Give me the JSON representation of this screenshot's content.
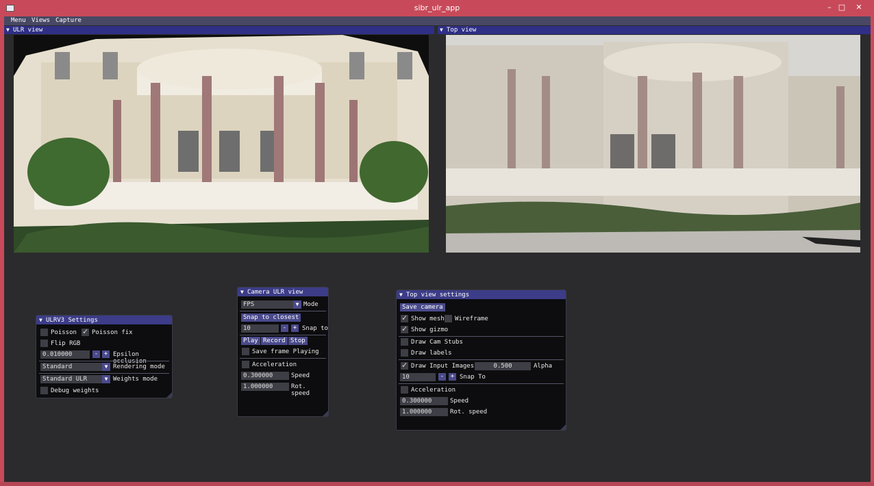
{
  "window": {
    "title": "sibr_ulr_app",
    "minimize": "–",
    "maximize": "□",
    "close": "✕"
  },
  "menu": [
    "Menu",
    "Views",
    "Capture"
  ],
  "ulr_view": {
    "label": "ULR view"
  },
  "top_view": {
    "label": "Top view"
  },
  "ulrv3": {
    "title": "ULRV3 Settings",
    "poisson": "Poisson",
    "poisson_fix": "Poisson fix",
    "flip_rgb": "Flip RGB",
    "epsilon_value": "0.010000",
    "epsilon_label": "Epsilon occlusion",
    "minus": "-",
    "plus": "+",
    "rendering_value": "Standard",
    "rendering_label": "Rendering mode",
    "weights_value": "Standard ULR",
    "weights_label": "Weights mode",
    "debug_weights": "Debug weights"
  },
  "camera": {
    "title": "Camera ULR view",
    "mode_value": "FPS",
    "mode_label": "Mode",
    "snap_closest": "Snap to closest",
    "snap_value": "10",
    "snap_label": "Snap to",
    "play": "Play",
    "record": "Record",
    "stop": "Stop",
    "save_frame": "Save frame Playing",
    "acceleration": "Acceleration",
    "speed_value": "0.300000",
    "speed_label": "Speed",
    "rot_value": "1.000000",
    "rot_label": "Rot. speed"
  },
  "topview_settings": {
    "title": "Top view settings",
    "save_camera": "Save camera",
    "show_mesh": "Show mesh",
    "wireframe": "Wireframe",
    "show_gizmo": "Show gizmo",
    "draw_cam_stubs": "Draw Cam Stubs",
    "draw_labels": "Draw labels",
    "draw_input_images": "Draw Input Images",
    "alpha_value": "0.500",
    "alpha_label": "Alpha",
    "snap_value": "10",
    "snap_label": "Snap To",
    "acceleration": "Acceleration",
    "speed_value": "0.300000",
    "speed_label": "Speed",
    "rot_value": "1.000000",
    "rot_label": "Rot. speed"
  },
  "colors": {
    "accent": "#4a4a8c",
    "frame": "#c84a5a",
    "header": "#2f2f86",
    "background": "#2b2b2d"
  }
}
